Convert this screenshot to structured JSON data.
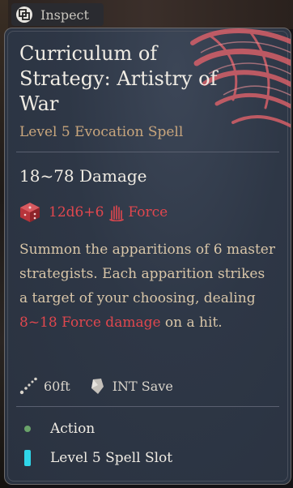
{
  "inspect": {
    "label": "Inspect"
  },
  "spell": {
    "name": "Curriculum of Strategy: Artistry of War",
    "subtitle": "Level 5 Evocation Spell",
    "damage_text": "18~78 Damage",
    "dice": "12d6+6",
    "damage_type": "Force",
    "description_parts": [
      "Summon the apparitions of 6 master strategists. Each apparition strikes a target of your choosing, dealing ",
      "8~18 Force damage",
      " on a hit."
    ],
    "range": "60ft",
    "save": "INT Save",
    "costs": [
      "Action",
      "Level 5 Spell Slot"
    ]
  },
  "colors": {
    "accent_red": "#e0474e",
    "subtitle_gold": "#c9a67d",
    "action_green": "#6aa36a",
    "spell_slot_cyan": "#2fd6ea"
  },
  "icons": {
    "inspect": "inspect-icon",
    "dice": "dice-icon",
    "force": "force-hand-icon",
    "range": "range-icon",
    "save": "saving-throw-icon",
    "action": "action-dot-icon",
    "slot": "spell-slot-icon"
  }
}
